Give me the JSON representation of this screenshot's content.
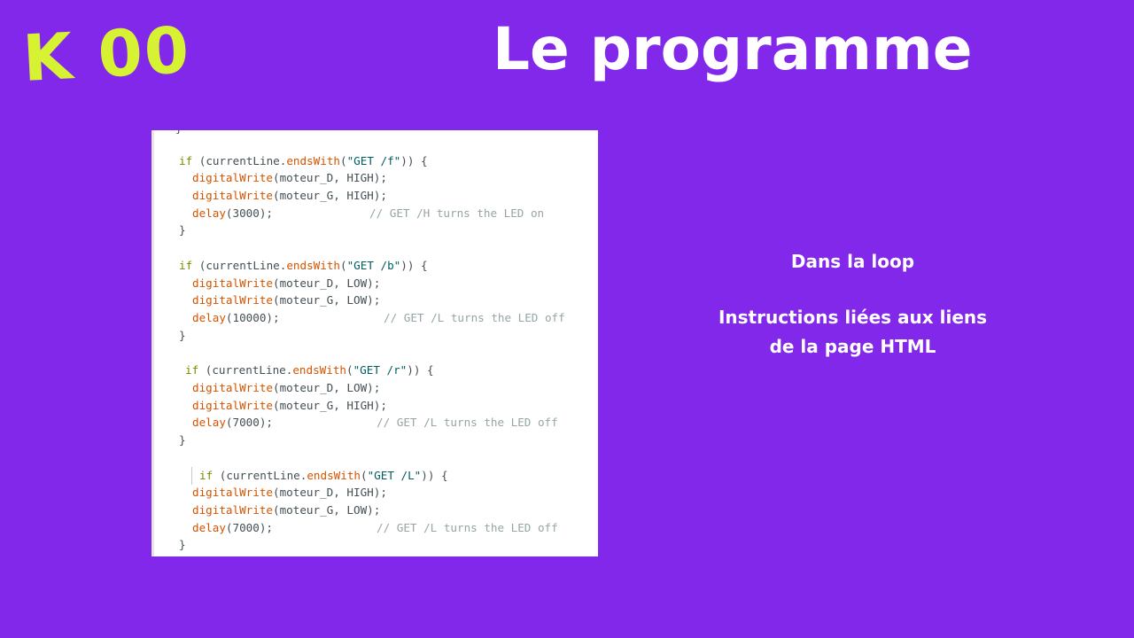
{
  "logo": {
    "text": "K 00"
  },
  "header": {
    "title": "Le programme"
  },
  "sidebar_text": {
    "line1": "Dans la loop",
    "line2": "Instructions liées aux liens",
    "line3": "de la page HTML"
  },
  "code": {
    "top_brace": "}",
    "block1": {
      "if_kw": "if",
      "cond_pre": " (currentLine.",
      "method": "endsWith",
      "arg": "\"GET /f\"",
      "cond_post": ")) {",
      "w1_fn": "digitalWrite",
      "w1_args": "(moteur_D, HIGH);",
      "w2_fn": "digitalWrite",
      "w2_args": "(moteur_G, HIGH);",
      "d_fn": "delay",
      "d_args": "(3000);",
      "comment": "// GET /H turns the LED on",
      "close": "}"
    },
    "block2": {
      "if_kw": "if",
      "cond_pre": " (currentLine.",
      "method": "endsWith",
      "arg": "\"GET /b\"",
      "cond_post": ")) {",
      "w1_fn": "digitalWrite",
      "w1_args": "(moteur_D, LOW);",
      "w2_fn": "digitalWrite",
      "w2_args": "(moteur_G, LOW);",
      "d_fn": "delay",
      "d_args": "(10000);",
      "comment": "// GET /L turns the LED off",
      "close": "}"
    },
    "block3": {
      "if_kw": "if",
      "cond_pre": " (currentLine.",
      "method": "endsWith",
      "arg": "\"GET /r\"",
      "cond_post": ")) {",
      "w1_fn": "digitalWrite",
      "w1_args": "(moteur_D, LOW);",
      "w2_fn": "digitalWrite",
      "w2_args": "(moteur_G, HIGH);",
      "d_fn": "delay",
      "d_args": "(7000);",
      "comment": "// GET /L turns the LED off",
      "close": "}"
    },
    "block4": {
      "if_kw": "if",
      "cond_pre": " (currentLine.",
      "method": "endsWith",
      "arg": "\"GET /L\"",
      "cond_post": ")) {",
      "w1_fn": "digitalWrite",
      "w1_args": "(moteur_D, HIGH);",
      "w2_fn": "digitalWrite",
      "w2_args": "(moteur_G, LOW);",
      "d_fn": "delay",
      "d_args": "(7000);",
      "comment": "// GET /L turns the LED off",
      "close": "}"
    }
  }
}
